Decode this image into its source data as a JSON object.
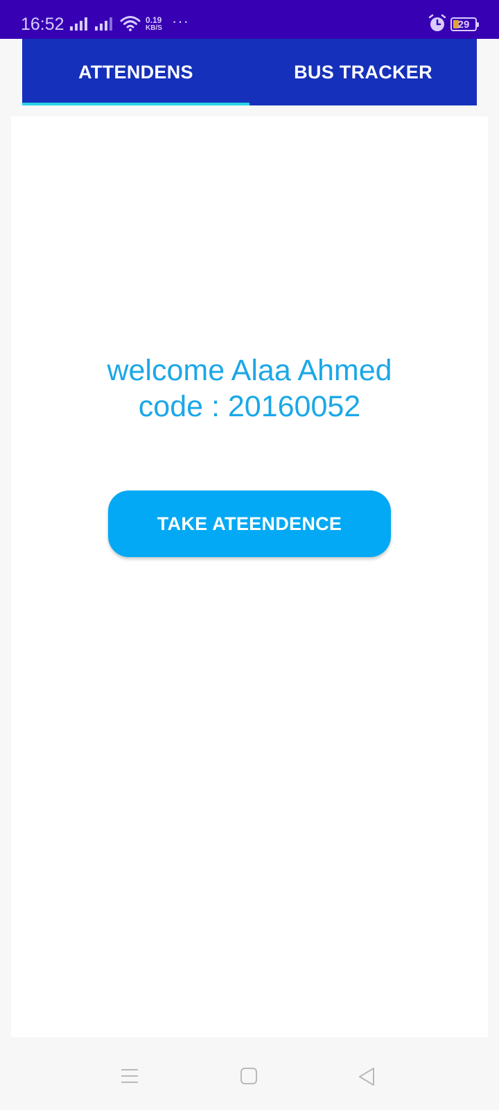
{
  "status_bar": {
    "time": "16:52",
    "net_speed_value": "0.19",
    "net_speed_unit": "KB/S",
    "more": "···",
    "battery_level": "29",
    "icons": [
      "signal-icon",
      "signal-icon",
      "wifi-icon",
      "alarm-icon",
      "battery-icon"
    ]
  },
  "tabs": [
    {
      "label": "ATTENDENS",
      "active": true
    },
    {
      "label": "BUS TRACKER",
      "active": false
    }
  ],
  "main": {
    "welcome_line": "welcome Alaa Ahmed",
    "code_line": "code : 20160052",
    "take_button_label": "TAKE ATEENDENCE"
  },
  "nav_bar": {
    "icons": [
      "menu-icon",
      "home-icon",
      "back-icon"
    ]
  },
  "colors": {
    "status_bar": "#3700b3",
    "tab_bar": "#1530ba",
    "tab_indicator": "#29d3e8",
    "accent_text": "#1ba7e7",
    "button": "#03a9f4"
  }
}
